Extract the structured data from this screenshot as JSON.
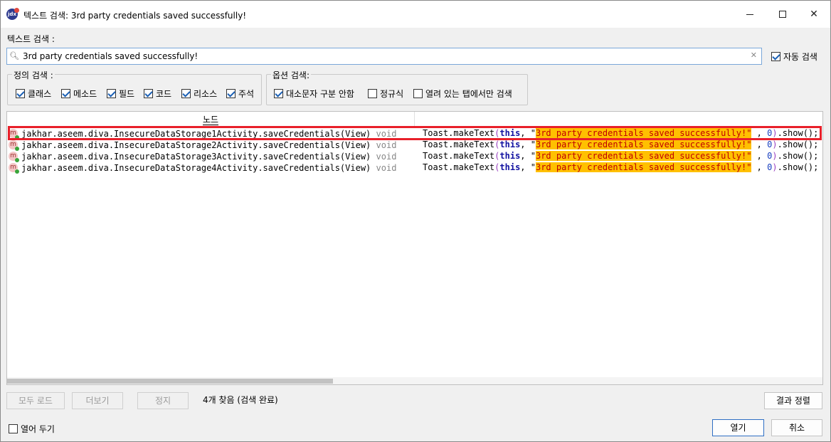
{
  "window": {
    "title": "텍스트 검색: 3rd party credentials saved successfully!",
    "app_icon_label": "jdx"
  },
  "search": {
    "label": "텍스트 검색 :",
    "value": "3rd party credentials saved successfully!",
    "auto_search_label": "자동 검색",
    "auto_search_checked": true
  },
  "definition_search": {
    "title": "정의 검색 :",
    "items": [
      {
        "label": "클래스",
        "checked": true
      },
      {
        "label": "메소드",
        "checked": true
      },
      {
        "label": "필드",
        "checked": true
      },
      {
        "label": "코드",
        "checked": true
      },
      {
        "label": "리소스",
        "checked": true
      },
      {
        "label": "주석",
        "checked": true
      }
    ]
  },
  "option_search": {
    "title": "옵션 검색:",
    "items": [
      {
        "label": "대소문자 구분 안함",
        "checked": true
      },
      {
        "label": "정규식",
        "checked": false
      },
      {
        "label": "열려 있는 탭에서만 검색",
        "checked": false
      }
    ]
  },
  "results": {
    "column_node": "노드",
    "rows": [
      {
        "node": "jakhar.aseem.diva.InsecureDataStorage1Activity.saveCredentials(View)",
        "ret": "void",
        "code_pre": "Toast.makeText",
        "kw": "this",
        "str": "3rd party credentials saved successfully!\"",
        "num": "0",
        "code_post": ".show();"
      },
      {
        "node": "jakhar.aseem.diva.InsecureDataStorage2Activity.saveCredentials(View)",
        "ret": "void",
        "code_pre": "Toast.makeText",
        "kw": "this",
        "str": "3rd party credentials saved successfully!\"",
        "num": "0",
        "code_post": ".show();"
      },
      {
        "node": "jakhar.aseem.diva.InsecureDataStorage3Activity.saveCredentials(View)",
        "ret": "void",
        "code_pre": "Toast.makeText",
        "kw": "this",
        "str": "3rd party credentials saved successfully!\"",
        "num": "0",
        "code_post": ".show();"
      },
      {
        "node": "jakhar.aseem.diva.InsecureDataStorage4Activity.saveCredentials(View)",
        "ret": "void",
        "code_pre": "Toast.makeText",
        "kw": "this",
        "str": "3rd party credentials saved successfully!\"",
        "num": "0",
        "code_post": ".show();"
      }
    ],
    "method_icon_letter": "m"
  },
  "footer": {
    "load_all": "모두 로드",
    "more": "더보기",
    "stop": "정지",
    "status": "4개 찾음 (검색 완료)",
    "sort": "결과 정렬",
    "keep_open_label": "열어 두기",
    "keep_open_checked": false,
    "open": "열기",
    "cancel": "취소"
  },
  "colors": {
    "highlight_frame": "#e8202a",
    "match_background": "#ffc000",
    "string_text": "#c00000",
    "keyword": "#1010a0"
  }
}
